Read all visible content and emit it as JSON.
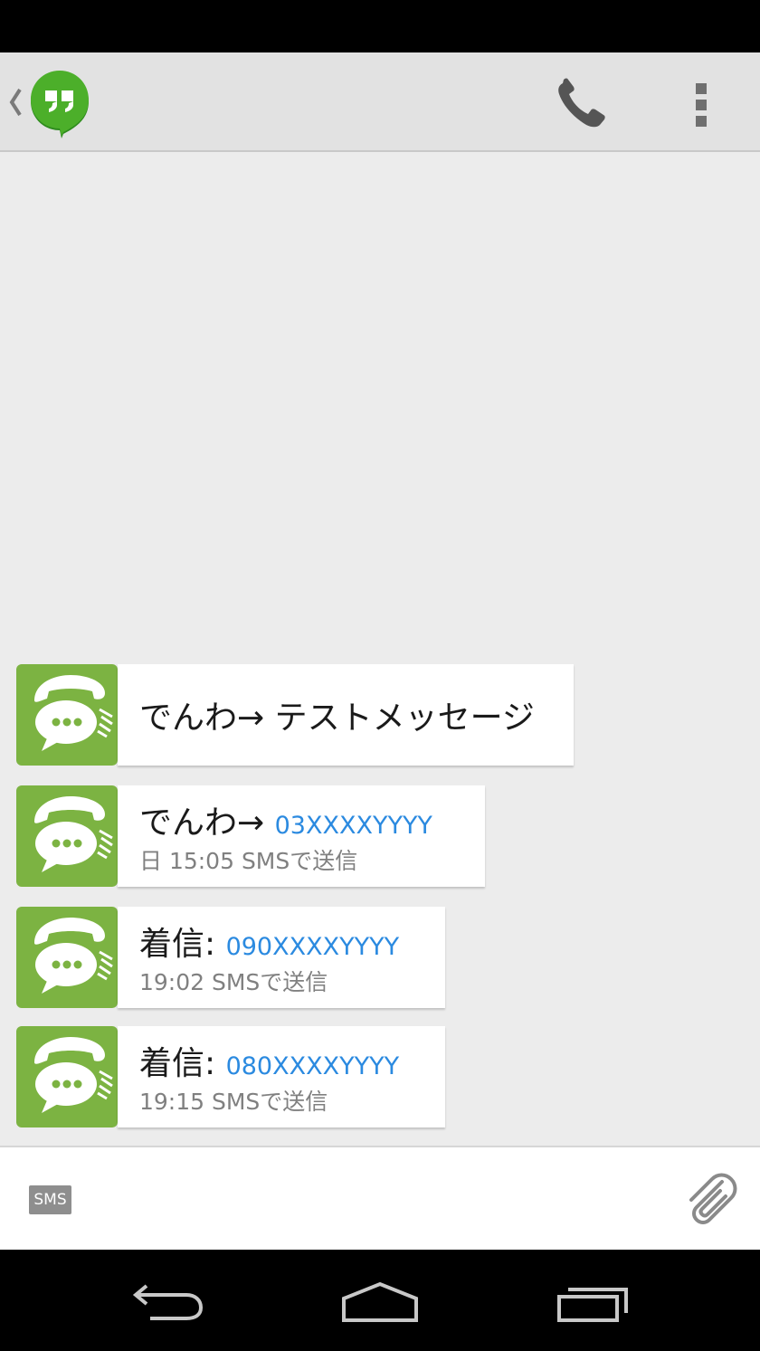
{
  "colors": {
    "status_bar": "#000000",
    "action_bar": "#e2e2e2",
    "conversation_bg": "#ececec",
    "avatar_green": "#7cb342",
    "link_blue": "#2b8ae0",
    "timestamp_gray": "#808080"
  },
  "header": {
    "up_icon": "chevron-left-icon",
    "app_logo_icon": "hangouts-quote-icon",
    "call_icon": "phone-icon",
    "overflow_icon": "more-vert-icon"
  },
  "messages": [
    {
      "prefix": "でんわ→ テストメッセージ",
      "link": "",
      "meta": ""
    },
    {
      "prefix": "でんわ→ ",
      "link": "03XXXXYYYY",
      "meta": "日 15:05 SMSで送信"
    },
    {
      "prefix": "着信: ",
      "link": "090XXXXYYYY",
      "meta": "19:02 SMSで送信"
    },
    {
      "prefix": "着信: ",
      "link": "080XXXXYYYY",
      "meta": "19:15 SMSで送信"
    }
  ],
  "compose": {
    "sms_badge": "SMS",
    "placeholder": "",
    "attach_icon": "paperclip-icon"
  },
  "nav": {
    "back_icon": "back-arrow-icon",
    "home_icon": "home-icon",
    "recents_icon": "recent-apps-icon"
  }
}
